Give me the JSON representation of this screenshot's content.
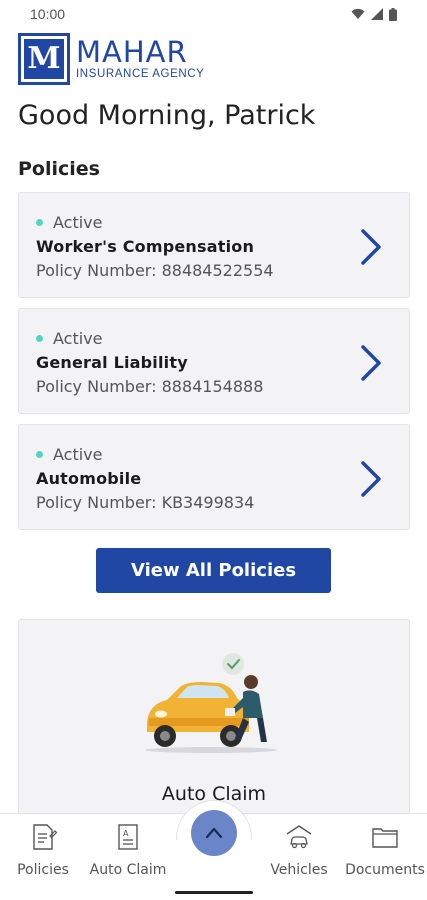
{
  "status_bar": {
    "time": "10:00"
  },
  "logo": {
    "mark": "M",
    "name": "MAHAR",
    "subtitle": "INSURANCE AGENCY"
  },
  "greeting": "Good Morning, Patrick",
  "policies_section": {
    "title": "Policies",
    "items": [
      {
        "status": "Active",
        "name": "Worker's Compensation",
        "policy_number": "Policy Number: 88484522554"
      },
      {
        "status": "Active",
        "name": "General Liability",
        "policy_number": "Policy Number: 8884154888"
      },
      {
        "status": "Active",
        "name": "Automobile",
        "policy_number": "Policy Number: KB3499834"
      }
    ],
    "view_all_label": "View All Policies"
  },
  "auto_claim_card": {
    "title": "Auto Claim",
    "illustration": "auto-claim-illustration"
  },
  "bottom_nav": {
    "items": [
      {
        "label": "Policies",
        "icon": "policy-document-icon"
      },
      {
        "label": "Auto Claim",
        "icon": "claim-form-icon"
      },
      {
        "label": "Vehicles",
        "icon": "car-garage-icon"
      },
      {
        "label": "Documents",
        "icon": "folder-icon"
      }
    ],
    "center_button_icon": "chevron-up-icon"
  },
  "colors": {
    "brand_blue": "#2147a5",
    "active_dot": "#4fd7c4",
    "fab": "#6a86c8",
    "card_bg": "#f3f3f5"
  }
}
